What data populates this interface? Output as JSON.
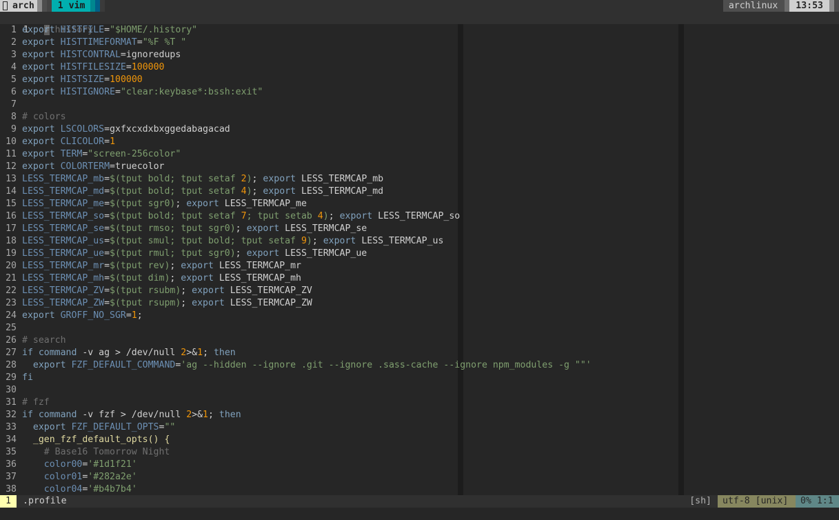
{
  "tmux": {
    "session_name": "arch",
    "window_label": "1 vim",
    "hostname": "archlinux",
    "clock": "13:53"
  },
  "editor": {
    "current_line": {
      "number": "1",
      "text": "# history"
    },
    "lines": [
      {
        "n": "1",
        "tokens": [
          [
            "kw",
            "export "
          ],
          [
            "var",
            "HISTFILE"
          ],
          [
            "txt",
            "="
          ],
          [
            "str",
            "\"$HOME/.history\""
          ]
        ]
      },
      {
        "n": "2",
        "tokens": [
          [
            "kw",
            "export "
          ],
          [
            "var",
            "HISTTIMEFORMAT"
          ],
          [
            "txt",
            "="
          ],
          [
            "str",
            "\"%F %T \""
          ]
        ]
      },
      {
        "n": "3",
        "tokens": [
          [
            "kw",
            "export "
          ],
          [
            "var",
            "HISTCONTRAL"
          ],
          [
            "txt",
            "=ignoredups"
          ]
        ]
      },
      {
        "n": "4",
        "tokens": [
          [
            "kw",
            "export "
          ],
          [
            "var",
            "HISTFILESIZE"
          ],
          [
            "txt",
            "="
          ],
          [
            "num",
            "100000"
          ]
        ]
      },
      {
        "n": "5",
        "tokens": [
          [
            "kw",
            "export "
          ],
          [
            "var",
            "HISTSIZE"
          ],
          [
            "txt",
            "="
          ],
          [
            "num",
            "100000"
          ]
        ]
      },
      {
        "n": "6",
        "tokens": [
          [
            "kw",
            "export "
          ],
          [
            "var",
            "HISTIGNORE"
          ],
          [
            "txt",
            "="
          ],
          [
            "str",
            "\"clear:keybase*:bssh:exit\""
          ]
        ]
      },
      {
        "n": "7",
        "tokens": []
      },
      {
        "n": "8",
        "tokens": [
          [
            "cm",
            "# colors"
          ]
        ]
      },
      {
        "n": "9",
        "tokens": [
          [
            "kw",
            "export "
          ],
          [
            "var",
            "LSCOLORS"
          ],
          [
            "txt",
            "=gxfxcxdxbxggedabagacad"
          ]
        ]
      },
      {
        "n": "10",
        "tokens": [
          [
            "kw",
            "export "
          ],
          [
            "var",
            "CLICOLOR"
          ],
          [
            "txt",
            "="
          ],
          [
            "num",
            "1"
          ]
        ]
      },
      {
        "n": "11",
        "tokens": [
          [
            "kw",
            "export "
          ],
          [
            "var",
            "TERM"
          ],
          [
            "txt",
            "="
          ],
          [
            "str",
            "\"screen-256color\""
          ]
        ]
      },
      {
        "n": "12",
        "tokens": [
          [
            "kw",
            "export "
          ],
          [
            "var",
            "COLORTERM"
          ],
          [
            "txt",
            "=truecolor"
          ]
        ]
      },
      {
        "n": "13",
        "tokens": [
          [
            "var",
            "LESS_TERMCAP_mb"
          ],
          [
            "txt",
            "="
          ],
          [
            "str",
            "$(tput bold; tput setaf "
          ],
          [
            "num",
            "2"
          ],
          [
            "str",
            ")"
          ],
          [
            "txt",
            "; "
          ],
          [
            "kw",
            "export "
          ],
          [
            "txt",
            "LESS_TERMCAP_mb"
          ]
        ]
      },
      {
        "n": "14",
        "tokens": [
          [
            "var",
            "LESS_TERMCAP_md"
          ],
          [
            "txt",
            "="
          ],
          [
            "str",
            "$(tput bold; tput setaf "
          ],
          [
            "num",
            "4"
          ],
          [
            "str",
            ")"
          ],
          [
            "txt",
            "; "
          ],
          [
            "kw",
            "export "
          ],
          [
            "txt",
            "LESS_TERMCAP_md"
          ]
        ]
      },
      {
        "n": "15",
        "tokens": [
          [
            "var",
            "LESS_TERMCAP_me"
          ],
          [
            "txt",
            "="
          ],
          [
            "str",
            "$(tput sgr0)"
          ],
          [
            "txt",
            "; "
          ],
          [
            "kw",
            "export "
          ],
          [
            "txt",
            "LESS_TERMCAP_me"
          ]
        ]
      },
      {
        "n": "16",
        "tokens": [
          [
            "var",
            "LESS_TERMCAP_so"
          ],
          [
            "txt",
            "="
          ],
          [
            "str",
            "$(tput bold; tput setaf "
          ],
          [
            "num",
            "7"
          ],
          [
            "str",
            "; tput setab "
          ],
          [
            "num",
            "4"
          ],
          [
            "str",
            ")"
          ],
          [
            "txt",
            "; "
          ],
          [
            "kw",
            "export "
          ],
          [
            "txt",
            "LESS_TERMCAP_so"
          ]
        ]
      },
      {
        "n": "17",
        "tokens": [
          [
            "var",
            "LESS_TERMCAP_se"
          ],
          [
            "txt",
            "="
          ],
          [
            "str",
            "$(tput rmso; tput sgr0)"
          ],
          [
            "txt",
            "; "
          ],
          [
            "kw",
            "export "
          ],
          [
            "txt",
            "LESS_TERMCAP_se"
          ]
        ]
      },
      {
        "n": "18",
        "tokens": [
          [
            "var",
            "LESS_TERMCAP_us"
          ],
          [
            "txt",
            "="
          ],
          [
            "str",
            "$(tput smul; tput bold; tput setaf "
          ],
          [
            "num",
            "9"
          ],
          [
            "str",
            ")"
          ],
          [
            "txt",
            "; "
          ],
          [
            "kw",
            "export "
          ],
          [
            "txt",
            "LESS_TERMCAP_us"
          ]
        ]
      },
      {
        "n": "19",
        "tokens": [
          [
            "var",
            "LESS_TERMCAP_ue"
          ],
          [
            "txt",
            "="
          ],
          [
            "str",
            "$(tput rmul; tput sgr0)"
          ],
          [
            "txt",
            "; "
          ],
          [
            "kw",
            "export "
          ],
          [
            "txt",
            "LESS_TERMCAP_ue"
          ]
        ]
      },
      {
        "n": "20",
        "tokens": [
          [
            "var",
            "LESS_TERMCAP_mr"
          ],
          [
            "txt",
            "="
          ],
          [
            "str",
            "$(tput rev)"
          ],
          [
            "txt",
            "; "
          ],
          [
            "kw",
            "export "
          ],
          [
            "txt",
            "LESS_TERMCAP_mr"
          ]
        ]
      },
      {
        "n": "21",
        "tokens": [
          [
            "var",
            "LESS_TERMCAP_mh"
          ],
          [
            "txt",
            "="
          ],
          [
            "str",
            "$(tput dim)"
          ],
          [
            "txt",
            "; "
          ],
          [
            "kw",
            "export "
          ],
          [
            "txt",
            "LESS_TERMCAP_mh"
          ]
        ]
      },
      {
        "n": "22",
        "tokens": [
          [
            "var",
            "LESS_TERMCAP_ZV"
          ],
          [
            "txt",
            "="
          ],
          [
            "str",
            "$(tput rsubm)"
          ],
          [
            "txt",
            "; "
          ],
          [
            "kw",
            "export "
          ],
          [
            "txt",
            "LESS_TERMCAP_ZV"
          ]
        ]
      },
      {
        "n": "23",
        "tokens": [
          [
            "var",
            "LESS_TERMCAP_ZW"
          ],
          [
            "txt",
            "="
          ],
          [
            "str",
            "$(tput rsupm)"
          ],
          [
            "txt",
            "; "
          ],
          [
            "kw",
            "export "
          ],
          [
            "txt",
            "LESS_TERMCAP_ZW"
          ]
        ]
      },
      {
        "n": "24",
        "tokens": [
          [
            "kw",
            "export "
          ],
          [
            "var",
            "GROFF_NO_SGR"
          ],
          [
            "txt",
            "="
          ],
          [
            "num",
            "1"
          ],
          [
            "txt",
            ";"
          ]
        ]
      },
      {
        "n": "25",
        "tokens": []
      },
      {
        "n": "26",
        "tokens": [
          [
            "cm",
            "# search"
          ]
        ]
      },
      {
        "n": "27",
        "tokens": [
          [
            "kw",
            "if "
          ],
          [
            "kw",
            "command"
          ],
          [
            "txt",
            " -v ag > /dev/null "
          ],
          [
            "num",
            "2"
          ],
          [
            "txt",
            ">&"
          ],
          [
            "num",
            "1"
          ],
          [
            "txt",
            "; "
          ],
          [
            "kw",
            "then"
          ]
        ]
      },
      {
        "n": "28",
        "tokens": [
          [
            "txt",
            "  "
          ],
          [
            "kw",
            "export "
          ],
          [
            "var",
            "FZF_DEFAULT_COMMAND"
          ],
          [
            "txt",
            "="
          ],
          [
            "str",
            "'ag --hidden --ignore .git --ignore .sass-cache --ignore npm_modules -g \"\"'"
          ]
        ]
      },
      {
        "n": "29",
        "tokens": [
          [
            "kw",
            "fi"
          ]
        ]
      },
      {
        "n": "30",
        "tokens": []
      },
      {
        "n": "31",
        "tokens": [
          [
            "cm",
            "# fzf"
          ]
        ]
      },
      {
        "n": "32",
        "tokens": [
          [
            "kw",
            "if "
          ],
          [
            "kw",
            "command"
          ],
          [
            "txt",
            " -v fzf > /dev/null "
          ],
          [
            "num",
            "2"
          ],
          [
            "txt",
            ">&"
          ],
          [
            "num",
            "1"
          ],
          [
            "txt",
            "; "
          ],
          [
            "kw",
            "then"
          ]
        ]
      },
      {
        "n": "33",
        "tokens": [
          [
            "txt",
            "  "
          ],
          [
            "kw",
            "export "
          ],
          [
            "var",
            "FZF_DEFAULT_OPTS"
          ],
          [
            "txt",
            "="
          ],
          [
            "str",
            "\"\""
          ]
        ]
      },
      {
        "n": "34",
        "tokens": [
          [
            "txt",
            "  "
          ],
          [
            "fn",
            "_gen_fzf_default_opts() {"
          ]
        ]
      },
      {
        "n": "35",
        "tokens": [
          [
            "txt",
            "    "
          ],
          [
            "cm",
            "# Base16 Tomorrow Night"
          ]
        ]
      },
      {
        "n": "36",
        "tokens": [
          [
            "txt",
            "    "
          ],
          [
            "var",
            "color00"
          ],
          [
            "txt",
            "="
          ],
          [
            "str",
            "'#1d1f21'"
          ]
        ]
      },
      {
        "n": "37",
        "tokens": [
          [
            "txt",
            "    "
          ],
          [
            "var",
            "color01"
          ],
          [
            "txt",
            "="
          ],
          [
            "str",
            "'#282a2e'"
          ]
        ]
      },
      {
        "n": "38",
        "tokens": [
          [
            "txt",
            "    "
          ],
          [
            "var",
            "color04"
          ],
          [
            "txt",
            "="
          ],
          [
            "str",
            "'#b4b7b4'"
          ]
        ]
      }
    ]
  },
  "statusline": {
    "buffer_number": "1",
    "filename": ".profile",
    "filetype": "[sh]",
    "encoding": "utf-8 [unix]",
    "position": "0% 1:1"
  }
}
